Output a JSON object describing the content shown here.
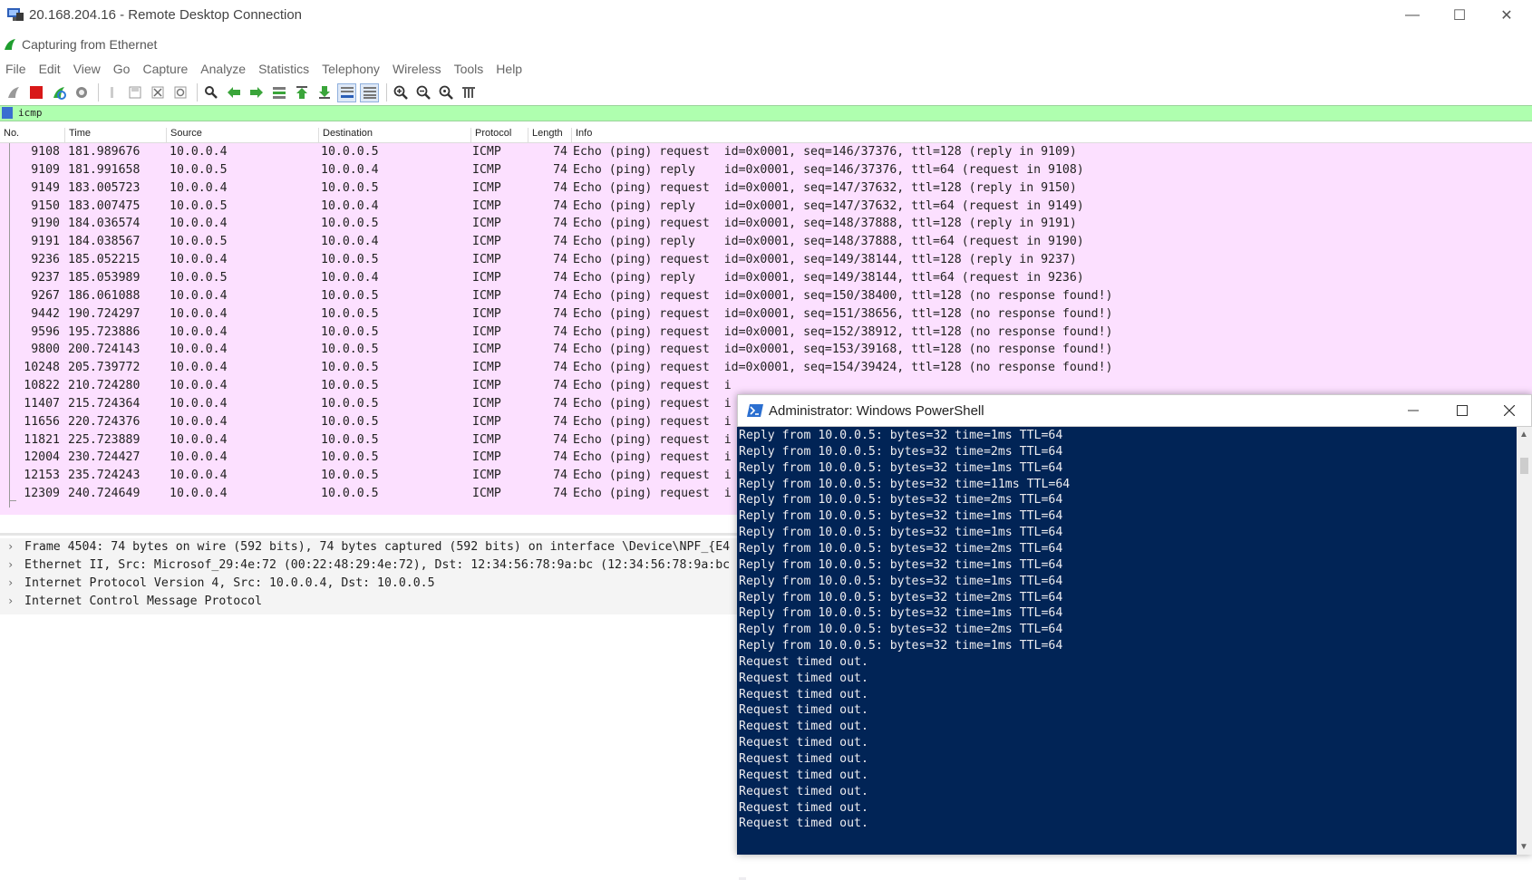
{
  "rdp": {
    "title": "20.168.204.16 - Remote Desktop Connection",
    "minimize": "—",
    "maximize": "☐",
    "close": "✕"
  },
  "wireshark": {
    "title": "Capturing from Ethernet",
    "menu": [
      "File",
      "Edit",
      "View",
      "Go",
      "Capture",
      "Analyze",
      "Statistics",
      "Telephony",
      "Wireless",
      "Tools",
      "Help"
    ],
    "filter": "icmp",
    "columns": {
      "no": "No.",
      "time": "Time",
      "source": "Source",
      "destination": "Destination",
      "protocol": "Protocol",
      "length": "Length",
      "info": "Info"
    },
    "packets": [
      {
        "no": "9108",
        "time": "181.989676",
        "src": "10.0.0.4",
        "dst": "10.0.0.5",
        "proto": "ICMP",
        "len": "74",
        "info": "Echo (ping) request  id=0x0001, seq=146/37376, ttl=128 (reply in 9109)"
      },
      {
        "no": "9109",
        "time": "181.991658",
        "src": "10.0.0.5",
        "dst": "10.0.0.4",
        "proto": "ICMP",
        "len": "74",
        "info": "Echo (ping) reply    id=0x0001, seq=146/37376, ttl=64 (request in 9108)"
      },
      {
        "no": "9149",
        "time": "183.005723",
        "src": "10.0.0.4",
        "dst": "10.0.0.5",
        "proto": "ICMP",
        "len": "74",
        "info": "Echo (ping) request  id=0x0001, seq=147/37632, ttl=128 (reply in 9150)"
      },
      {
        "no": "9150",
        "time": "183.007475",
        "src": "10.0.0.5",
        "dst": "10.0.0.4",
        "proto": "ICMP",
        "len": "74",
        "info": "Echo (ping) reply    id=0x0001, seq=147/37632, ttl=64 (request in 9149)"
      },
      {
        "no": "9190",
        "time": "184.036574",
        "src": "10.0.0.4",
        "dst": "10.0.0.5",
        "proto": "ICMP",
        "len": "74",
        "info": "Echo (ping) request  id=0x0001, seq=148/37888, ttl=128 (reply in 9191)"
      },
      {
        "no": "9191",
        "time": "184.038567",
        "src": "10.0.0.5",
        "dst": "10.0.0.4",
        "proto": "ICMP",
        "len": "74",
        "info": "Echo (ping) reply    id=0x0001, seq=148/37888, ttl=64 (request in 9190)"
      },
      {
        "no": "9236",
        "time": "185.052215",
        "src": "10.0.0.4",
        "dst": "10.0.0.5",
        "proto": "ICMP",
        "len": "74",
        "info": "Echo (ping) request  id=0x0001, seq=149/38144, ttl=128 (reply in 9237)"
      },
      {
        "no": "9237",
        "time": "185.053989",
        "src": "10.0.0.5",
        "dst": "10.0.0.4",
        "proto": "ICMP",
        "len": "74",
        "info": "Echo (ping) reply    id=0x0001, seq=149/38144, ttl=64 (request in 9236)"
      },
      {
        "no": "9267",
        "time": "186.061088",
        "src": "10.0.0.4",
        "dst": "10.0.0.5",
        "proto": "ICMP",
        "len": "74",
        "info": "Echo (ping) request  id=0x0001, seq=150/38400, ttl=128 (no response found!)"
      },
      {
        "no": "9442",
        "time": "190.724297",
        "src": "10.0.0.4",
        "dst": "10.0.0.5",
        "proto": "ICMP",
        "len": "74",
        "info": "Echo (ping) request  id=0x0001, seq=151/38656, ttl=128 (no response found!)"
      },
      {
        "no": "9596",
        "time": "195.723886",
        "src": "10.0.0.4",
        "dst": "10.0.0.5",
        "proto": "ICMP",
        "len": "74",
        "info": "Echo (ping) request  id=0x0001, seq=152/38912, ttl=128 (no response found!)"
      },
      {
        "no": "9800",
        "time": "200.724143",
        "src": "10.0.0.4",
        "dst": "10.0.0.5",
        "proto": "ICMP",
        "len": "74",
        "info": "Echo (ping) request  id=0x0001, seq=153/39168, ttl=128 (no response found!)"
      },
      {
        "no": "10248",
        "time": "205.739772",
        "src": "10.0.0.4",
        "dst": "10.0.0.5",
        "proto": "ICMP",
        "len": "74",
        "info": "Echo (ping) request  id=0x0001, seq=154/39424, ttl=128 (no response found!)"
      },
      {
        "no": "10822",
        "time": "210.724280",
        "src": "10.0.0.4",
        "dst": "10.0.0.5",
        "proto": "ICMP",
        "len": "74",
        "info": "Echo (ping) request  i"
      },
      {
        "no": "11407",
        "time": "215.724364",
        "src": "10.0.0.4",
        "dst": "10.0.0.5",
        "proto": "ICMP",
        "len": "74",
        "info": "Echo (ping) request  i"
      },
      {
        "no": "11656",
        "time": "220.724376",
        "src": "10.0.0.4",
        "dst": "10.0.0.5",
        "proto": "ICMP",
        "len": "74",
        "info": "Echo (ping) request  i"
      },
      {
        "no": "11821",
        "time": "225.723889",
        "src": "10.0.0.4",
        "dst": "10.0.0.5",
        "proto": "ICMP",
        "len": "74",
        "info": "Echo (ping) request  i"
      },
      {
        "no": "12004",
        "time": "230.724427",
        "src": "10.0.0.4",
        "dst": "10.0.0.5",
        "proto": "ICMP",
        "len": "74",
        "info": "Echo (ping) request  i"
      },
      {
        "no": "12153",
        "time": "235.724243",
        "src": "10.0.0.4",
        "dst": "10.0.0.5",
        "proto": "ICMP",
        "len": "74",
        "info": "Echo (ping) request  i"
      },
      {
        "no": "12309",
        "time": "240.724649",
        "src": "10.0.0.4",
        "dst": "10.0.0.5",
        "proto": "ICMP",
        "len": "74",
        "info": "Echo (ping) request  i"
      }
    ],
    "details": [
      "Frame 4504: 74 bytes on wire (592 bits), 74 bytes captured (592 bits) on interface \\Device\\NPF_{E4",
      "Ethernet II, Src: Microsof_29:4e:72 (00:22:48:29:4e:72), Dst: 12:34:56:78:9a:bc (12:34:56:78:9a:bc",
      "Internet Protocol Version 4, Src: 10.0.0.4, Dst: 10.0.0.5",
      "Internet Control Message Protocol"
    ],
    "colors": {
      "row_bg": "#fce0ff",
      "filter_bg": "#afffaf"
    }
  },
  "powershell": {
    "title": "Administrator: Windows PowerShell",
    "lines": [
      "Reply from 10.0.0.5: bytes=32 time=1ms TTL=64",
      "Reply from 10.0.0.5: bytes=32 time=2ms TTL=64",
      "Reply from 10.0.0.5: bytes=32 time=1ms TTL=64",
      "Reply from 10.0.0.5: bytes=32 time=11ms TTL=64",
      "Reply from 10.0.0.5: bytes=32 time=2ms TTL=64",
      "Reply from 10.0.0.5: bytes=32 time=1ms TTL=64",
      "Reply from 10.0.0.5: bytes=32 time=1ms TTL=64",
      "Reply from 10.0.0.5: bytes=32 time=2ms TTL=64",
      "Reply from 10.0.0.5: bytes=32 time=1ms TTL=64",
      "Reply from 10.0.0.5: bytes=32 time=1ms TTL=64",
      "Reply from 10.0.0.5: bytes=32 time=2ms TTL=64",
      "Reply from 10.0.0.5: bytes=32 time=1ms TTL=64",
      "Reply from 10.0.0.5: bytes=32 time=2ms TTL=64",
      "Reply from 10.0.0.5: bytes=32 time=1ms TTL=64",
      "Request timed out.",
      "Request timed out.",
      "Request timed out.",
      "Request timed out.",
      "Request timed out.",
      "Request timed out.",
      "Request timed out.",
      "Request timed out.",
      "Request timed out.",
      "Request timed out.",
      "Request timed out."
    ],
    "colors": {
      "bg": "#012456",
      "fg": "#eeedf0"
    }
  }
}
